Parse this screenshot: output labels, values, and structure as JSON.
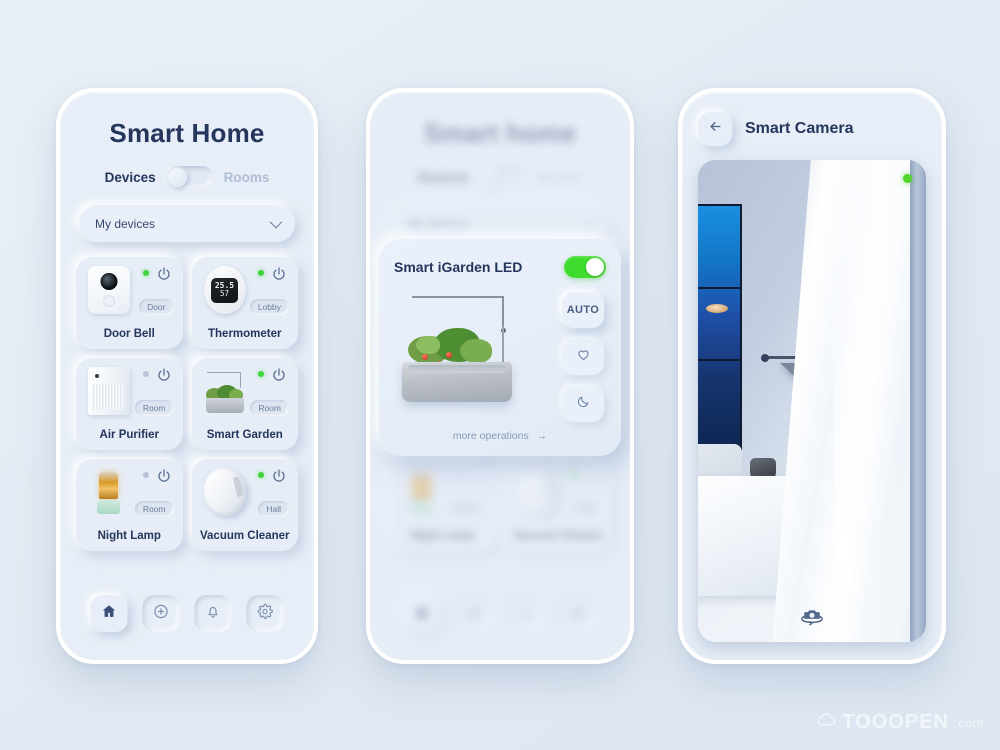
{
  "screen_home": {
    "title": "Smart Home",
    "segment": {
      "left_label": "Devices",
      "right_label": "Rooms",
      "active": "Devices"
    },
    "dropdown": {
      "value": "My devices",
      "icon": "chevron-down-icon"
    },
    "devices": [
      {
        "name": "Door Bell",
        "room": "Door",
        "status": "on",
        "thumb": "doorbell"
      },
      {
        "name": "Thermometer",
        "room": "Lobby",
        "status": "on",
        "thumb": "thermometer",
        "reading_temp": "25.5",
        "reading_humidity": "57"
      },
      {
        "name": "Air Purifier",
        "room": "Room",
        "status": "off",
        "thumb": "air-purifier"
      },
      {
        "name": "Smart Garden",
        "room": "Room",
        "status": "on",
        "thumb": "smart-garden"
      },
      {
        "name": "Night Lamp",
        "room": "Room",
        "status": "off",
        "thumb": "night-lamp"
      },
      {
        "name": "Vacuum Cleaner",
        "room": "Hall",
        "status": "on",
        "thumb": "vacuum-cleaner"
      }
    ],
    "nav": [
      {
        "icon": "home-icon",
        "active": true
      },
      {
        "icon": "plus-circle-icon",
        "active": false
      },
      {
        "icon": "bell-icon",
        "active": false
      },
      {
        "icon": "gear-icon",
        "active": false
      }
    ]
  },
  "screen_detail": {
    "background_title": "Smart home",
    "modal": {
      "title": "Smart iGarden LED",
      "power_toggle": {
        "state": "on",
        "color": "#3ddb2e"
      },
      "side_buttons": [
        {
          "label": "AUTO",
          "icon": "auto-text",
          "raised": true
        },
        {
          "label": "",
          "icon": "heart-icon",
          "raised": false
        },
        {
          "label": "",
          "icon": "moon-icon",
          "raised": false
        }
      ],
      "more_link": {
        "label": "more operations",
        "icon": "arrow-right-icon"
      }
    }
  },
  "screen_camera": {
    "back_icon": "arrow-left-icon",
    "title": "Smart Camera",
    "recording_indicator": {
      "color": "#53d62b",
      "state": "recording"
    },
    "control_icon": "camera-360-icon"
  },
  "watermark": {
    "text": "TOOOPEN",
    "suffix": ".com",
    "icon": "cloud-icon"
  },
  "colors": {
    "page_background": "#e5ebf3",
    "surface": "#e7eef7",
    "text_primary": "#25355c",
    "text_muted": "#8a99b4",
    "status_on": "#3cd639",
    "status_off": "#b6c3d6",
    "accent_green": "#3ddb2e"
  }
}
